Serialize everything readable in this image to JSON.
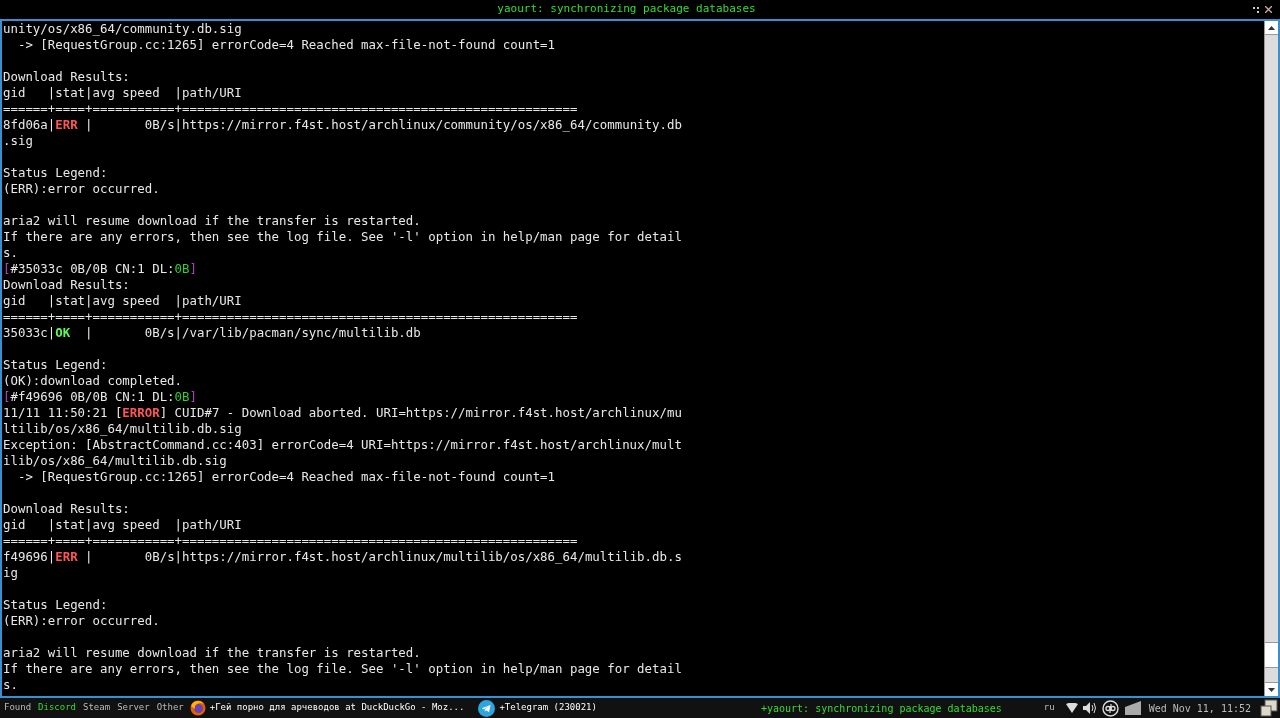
{
  "title_bar": {
    "title": "yaourt: synchronizing package databases"
  },
  "terminal": {
    "lines": [
      {
        "kind": "text",
        "segments": [
          {
            "kind": "plain",
            "text": "unity/os/x86_64/community.db.sig"
          }
        ]
      },
      {
        "kind": "text",
        "segments": [
          {
            "kind": "plain",
            "text": "  -> [RequestGroup.cc:1265] errorCode=4 Reached max-file-not-found count=1"
          }
        ]
      },
      {
        "kind": "blank"
      },
      {
        "kind": "text",
        "segments": [
          {
            "kind": "plain",
            "text": "Download Results:"
          }
        ]
      },
      {
        "kind": "text",
        "segments": [
          {
            "kind": "plain",
            "text": "gid   |stat|avg speed  |path/URI"
          }
        ]
      },
      {
        "kind": "text",
        "segments": [
          {
            "kind": "plain",
            "text": "======+====+===========+====================================================="
          }
        ]
      },
      {
        "kind": "text",
        "segments": [
          {
            "kind": "plain",
            "text": "8fd06a|"
          },
          {
            "kind": "err",
            "text": "ERR"
          },
          {
            "kind": "plain",
            "text": " |       0B/s|https://mirror.f4st.host/archlinux/community/os/x86_64/community.db"
          }
        ]
      },
      {
        "kind": "text",
        "segments": [
          {
            "kind": "plain",
            "text": ".sig"
          }
        ]
      },
      {
        "kind": "blank"
      },
      {
        "kind": "text",
        "segments": [
          {
            "kind": "plain",
            "text": "Status Legend:"
          }
        ]
      },
      {
        "kind": "text",
        "segments": [
          {
            "kind": "plain",
            "text": "(ERR):error occurred."
          }
        ]
      },
      {
        "kind": "blank"
      },
      {
        "kind": "text",
        "segments": [
          {
            "kind": "plain",
            "text": "aria2 will resume download if the transfer is restarted."
          }
        ]
      },
      {
        "kind": "text",
        "segments": [
          {
            "kind": "plain",
            "text": "If there are any errors, then see the log file. See '-l' option in help/man page for detail"
          }
        ]
      },
      {
        "kind": "text",
        "segments": [
          {
            "kind": "plain",
            "text": "s."
          }
        ]
      },
      {
        "kind": "text",
        "segments": [
          {
            "kind": "bracket",
            "text": "["
          },
          {
            "kind": "plain",
            "text": "#35033c 0B/0B CN:1 DL:"
          },
          {
            "kind": "dl",
            "text": "0B"
          },
          {
            "kind": "bracket",
            "text": "]"
          }
        ]
      },
      {
        "kind": "text",
        "segments": [
          {
            "kind": "plain",
            "text": "Download Results:"
          }
        ]
      },
      {
        "kind": "text",
        "segments": [
          {
            "kind": "plain",
            "text": "gid   |stat|avg speed  |path/URI"
          }
        ]
      },
      {
        "kind": "text",
        "segments": [
          {
            "kind": "plain",
            "text": "======+====+===========+====================================================="
          }
        ]
      },
      {
        "kind": "text",
        "segments": [
          {
            "kind": "plain",
            "text": "35033c|"
          },
          {
            "kind": "ok",
            "text": "OK"
          },
          {
            "kind": "plain",
            "text": "  |       0B/s|/var/lib/pacman/sync/multilib.db"
          }
        ]
      },
      {
        "kind": "blank"
      },
      {
        "kind": "text",
        "segments": [
          {
            "kind": "plain",
            "text": "Status Legend:"
          }
        ]
      },
      {
        "kind": "text",
        "segments": [
          {
            "kind": "plain",
            "text": "(OK):download completed."
          }
        ]
      },
      {
        "kind": "text",
        "segments": [
          {
            "kind": "bracket",
            "text": "["
          },
          {
            "kind": "plain",
            "text": "#f49696 0B/0B CN:1 DL:"
          },
          {
            "kind": "dl",
            "text": "0B"
          },
          {
            "kind": "bracket",
            "text": "]"
          }
        ]
      },
      {
        "kind": "text",
        "segments": [
          {
            "kind": "plain",
            "text": "11/11 11:50:21 ["
          },
          {
            "kind": "err",
            "text": "ERROR"
          },
          {
            "kind": "plain",
            "text": "] CUID#7 - Download aborted. URI=https://mirror.f4st.host/archlinux/mu"
          }
        ]
      },
      {
        "kind": "text",
        "segments": [
          {
            "kind": "plain",
            "text": "ltilib/os/x86_64/multilib.db.sig"
          }
        ]
      },
      {
        "kind": "text",
        "segments": [
          {
            "kind": "plain",
            "text": "Exception: [AbstractCommand.cc:403] errorCode=4 URI=https://mirror.f4st.host/archlinux/mult"
          }
        ]
      },
      {
        "kind": "text",
        "segments": [
          {
            "kind": "plain",
            "text": "ilib/os/x86_64/multilib.db.sig"
          }
        ]
      },
      {
        "kind": "text",
        "segments": [
          {
            "kind": "plain",
            "text": "  -> [RequestGroup.cc:1265] errorCode=4 Reached max-file-not-found count=1"
          }
        ]
      },
      {
        "kind": "blank"
      },
      {
        "kind": "text",
        "segments": [
          {
            "kind": "plain",
            "text": "Download Results:"
          }
        ]
      },
      {
        "kind": "text",
        "segments": [
          {
            "kind": "plain",
            "text": "gid   |stat|avg speed  |path/URI"
          }
        ]
      },
      {
        "kind": "text",
        "segments": [
          {
            "kind": "plain",
            "text": "======+====+===========+====================================================="
          }
        ]
      },
      {
        "kind": "text",
        "segments": [
          {
            "kind": "plain",
            "text": "f49696|"
          },
          {
            "kind": "err",
            "text": "ERR"
          },
          {
            "kind": "plain",
            "text": " |       0B/s|https://mirror.f4st.host/archlinux/multilib/os/x86_64/multilib.db.s"
          }
        ]
      },
      {
        "kind": "text",
        "segments": [
          {
            "kind": "plain",
            "text": "ig"
          }
        ]
      },
      {
        "kind": "blank"
      },
      {
        "kind": "text",
        "segments": [
          {
            "kind": "plain",
            "text": "Status Legend:"
          }
        ]
      },
      {
        "kind": "text",
        "segments": [
          {
            "kind": "plain",
            "text": "(ERR):error occurred."
          }
        ]
      },
      {
        "kind": "blank"
      },
      {
        "kind": "text",
        "segments": [
          {
            "kind": "plain",
            "text": "aria2 will resume download if the transfer is restarted."
          }
        ]
      },
      {
        "kind": "text",
        "segments": [
          {
            "kind": "plain",
            "text": "If there are any errors, then see the log file. See '-l' option in help/man page for detail"
          }
        ]
      },
      {
        "kind": "text",
        "segments": [
          {
            "kind": "plain",
            "text": "s."
          }
        ]
      }
    ]
  },
  "taskbar": {
    "workspaces": [
      {
        "label": "Found",
        "selected": false
      },
      {
        "label": "Discord",
        "selected": true
      },
      {
        "label": "Steam",
        "selected": false
      },
      {
        "label": "Server",
        "selected": false
      },
      {
        "label": "Other",
        "selected": false
      }
    ],
    "tasks": [
      {
        "kind": "browser",
        "label": "+Гей порно для арчеводов at DuckDuckGo - Moz...",
        "selected": false
      },
      {
        "kind": "messenger",
        "label": "+Telegram (230021)",
        "selected": false
      },
      {
        "kind": "terminal",
        "label": "+yaourt: synchronizing package databases",
        "selected": true
      }
    ],
    "keyboard_layout": "ru",
    "clock": "Wed Nov 11, 11:52"
  }
}
